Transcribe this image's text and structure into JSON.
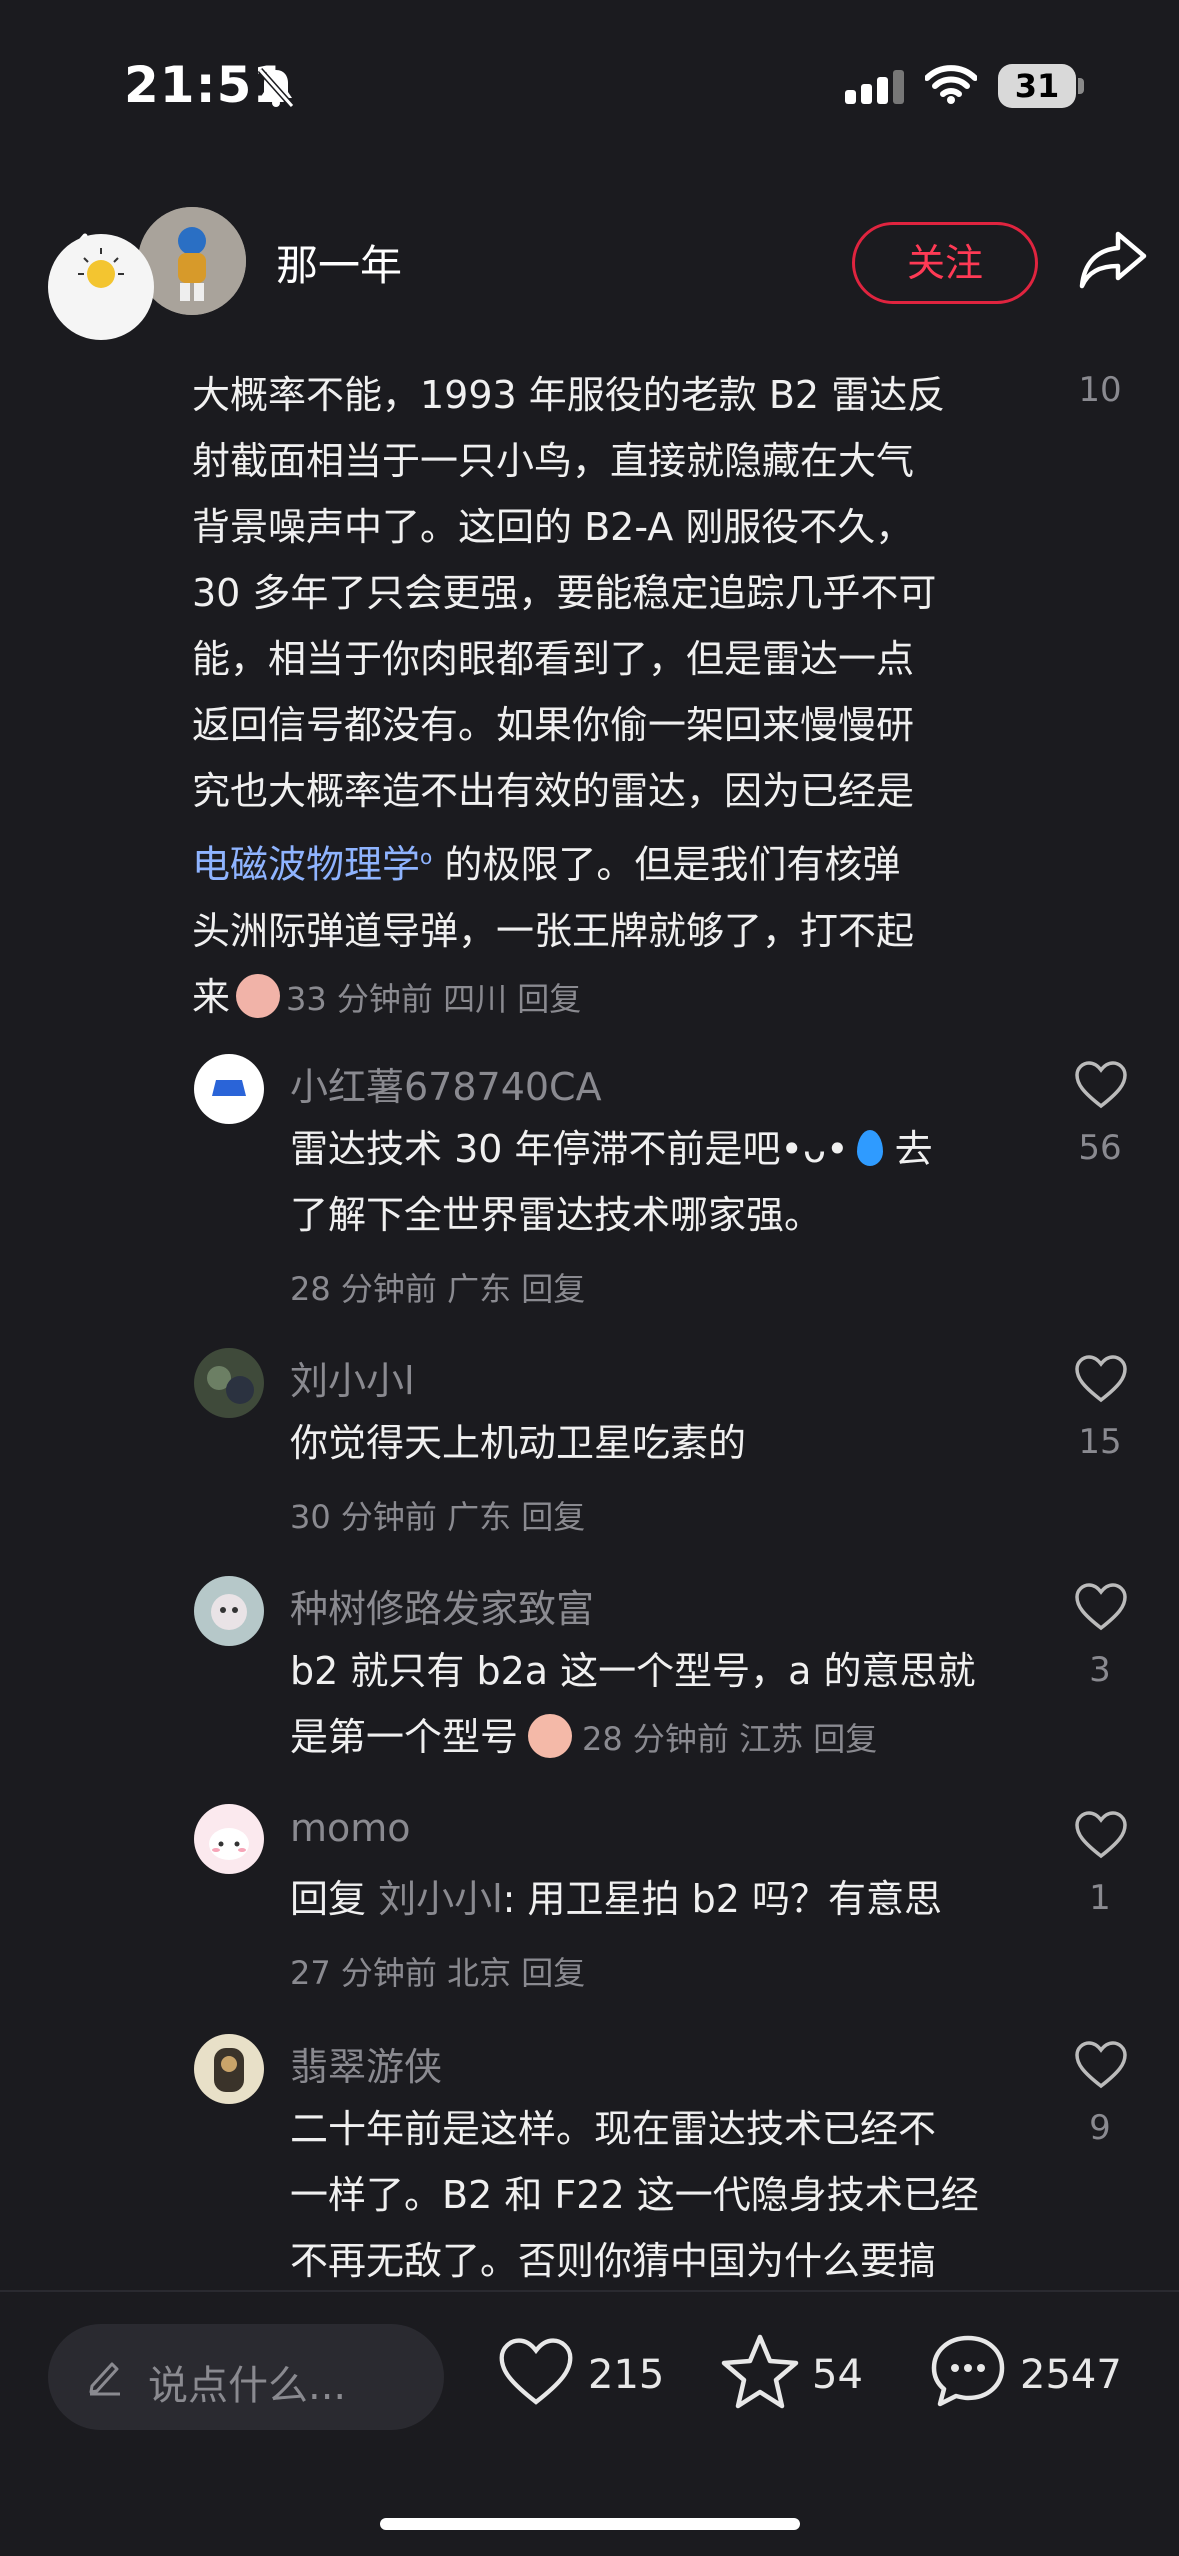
{
  "status": {
    "time": "21:51",
    "battery": "31"
  },
  "header": {
    "author": "那一年",
    "follow_label": "关注"
  },
  "main_comment": {
    "top_like_count": "10",
    "lines": [
      "大概率不能，1993 年服役的老款 B2 雷达反",
      "射截面相当于一只小鸟，直接就隐藏在大气",
      "背景噪声中了。这回的 B2-A 刚服役不久，",
      "30 多年了只会更强，要能稳定追踪几乎不可",
      "能，相当于你肉眼都看到了，但是雷达一点",
      "返回信号都没有。如果你偷一架回来慢慢研",
      "究也大概率造不出有效的雷达，因为已经是"
    ],
    "link_text": "电磁波物理学",
    "line8_rest": " 的极限了。但是我们有核弹",
    "line9": "头洲际弹道导弹，一张王牌就够了，打不起",
    "line10_start": "来",
    "meta": "33 分钟前  四川  回复"
  },
  "replies": [
    {
      "name": "小红薯678740CA",
      "line1": "雷达技术 30 年停滞不前是吧•ᴗ•",
      "line1_end": " 去",
      "line2": "了解下全世界雷达技术哪家强。",
      "meta": "28 分钟前  广东  回复",
      "likes": "56"
    },
    {
      "name": "刘小小l",
      "line1": "你觉得天上机动卫星吃素的",
      "meta": "30 分钟前  广东  回复",
      "likes": "15"
    },
    {
      "name": "种树修路发家致富",
      "line1": "b2 就只有 b2a 这一个型号，a 的意思就",
      "line2": "是第一个型号",
      "meta": "28 分钟前  江苏  回复",
      "likes": "3"
    },
    {
      "name": "momo",
      "reply_prefix": "回复 ",
      "reply_to": "刘小小l",
      "line1": ": 用卫星拍 b2 吗？有意思",
      "meta": "27 分钟前  北京  回复",
      "likes": "1"
    },
    {
      "name": "翡翠游侠",
      "line1": "二十年前是这样。现在雷达技术已经不",
      "line2": "一样了。B2 和 F22 这一代隐身技术已经",
      "line3": "不再无敌了。否则你猜中国为什么要搞",
      "likes": "9"
    }
  ],
  "bottom": {
    "input_placeholder": "说点什么...",
    "likes": "215",
    "favorites": "54",
    "comments": "2547"
  }
}
